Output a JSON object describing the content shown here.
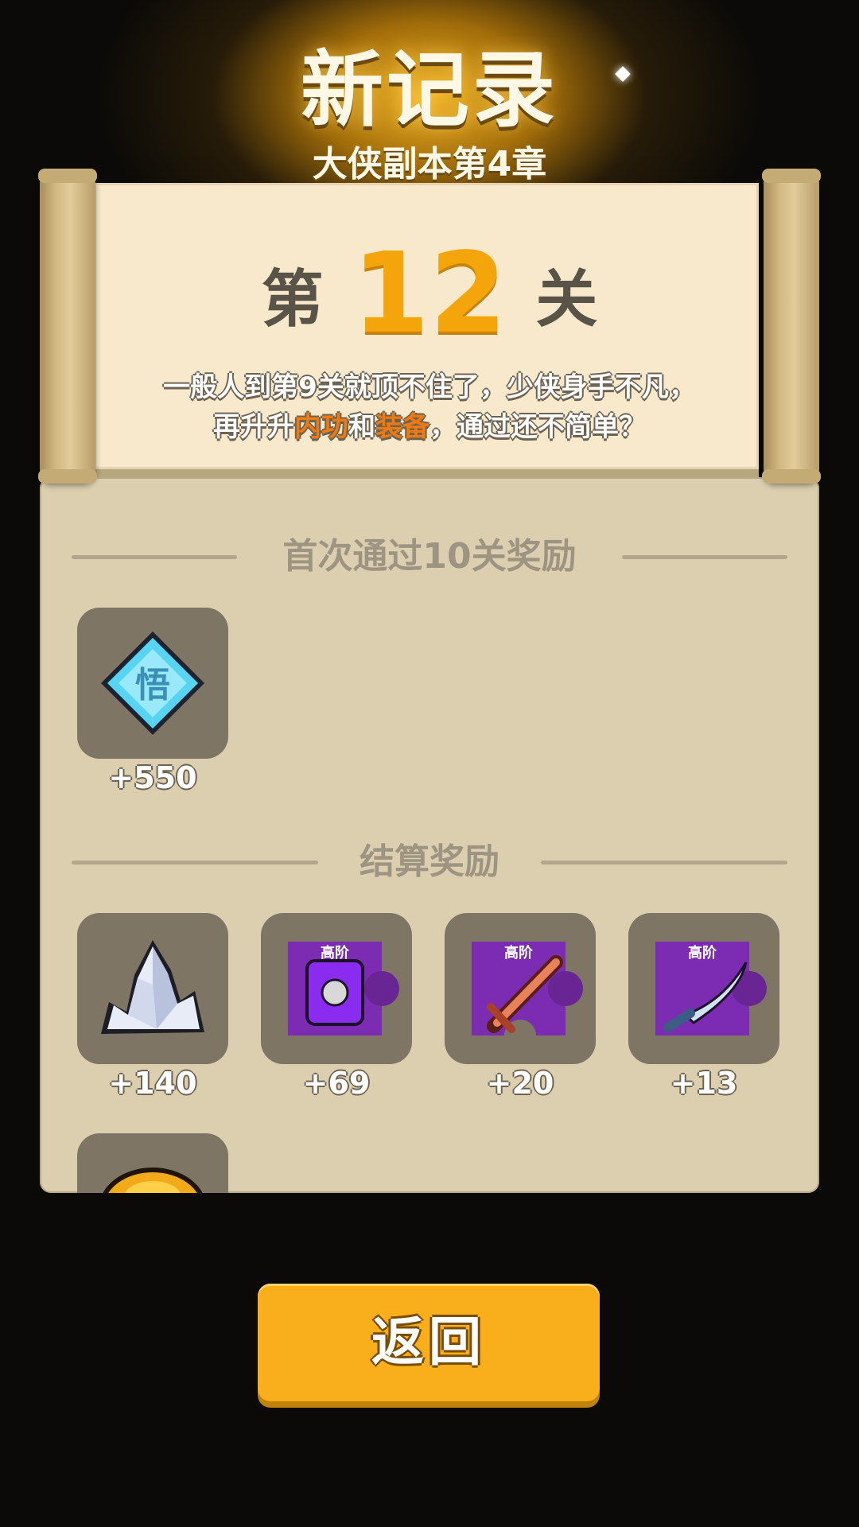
{
  "header": {
    "title": "新记录",
    "subtitle": "大侠副本第4章"
  },
  "level": {
    "prefix": "第",
    "number": "12",
    "suffix": "关"
  },
  "description": {
    "line1": "一般人到第9关就顶不住了，少侠身手不凡，",
    "line2_a": "再升升",
    "line2_hl1": "内功",
    "line2_b": "和",
    "line2_hl2": "装备",
    "line2_c": "，通过还不简单？"
  },
  "first_clear": {
    "label": "首次通过10关奖励",
    "items": [
      {
        "icon": "insight-gem-icon",
        "glyph": "悟",
        "count": "+550"
      }
    ]
  },
  "settlement": {
    "label": "结算奖励",
    "items": [
      {
        "icon": "crystal-icon",
        "count": "+140"
      },
      {
        "icon": "armor-fragment-icon",
        "tag": "高阶",
        "count": "+69"
      },
      {
        "icon": "sword-fragment-icon",
        "tag": "高阶",
        "count": "+20"
      },
      {
        "icon": "saber-fragment-icon",
        "tag": "高阶",
        "count": "+13"
      },
      {
        "icon": "gold-ingot-icon",
        "count": ""
      }
    ]
  },
  "buttons": {
    "back": "返回"
  },
  "colors": {
    "accent": "#f5a50c",
    "highlight": "#f07a12",
    "panel": "#dccfb0",
    "button": "#f9ae1b"
  }
}
